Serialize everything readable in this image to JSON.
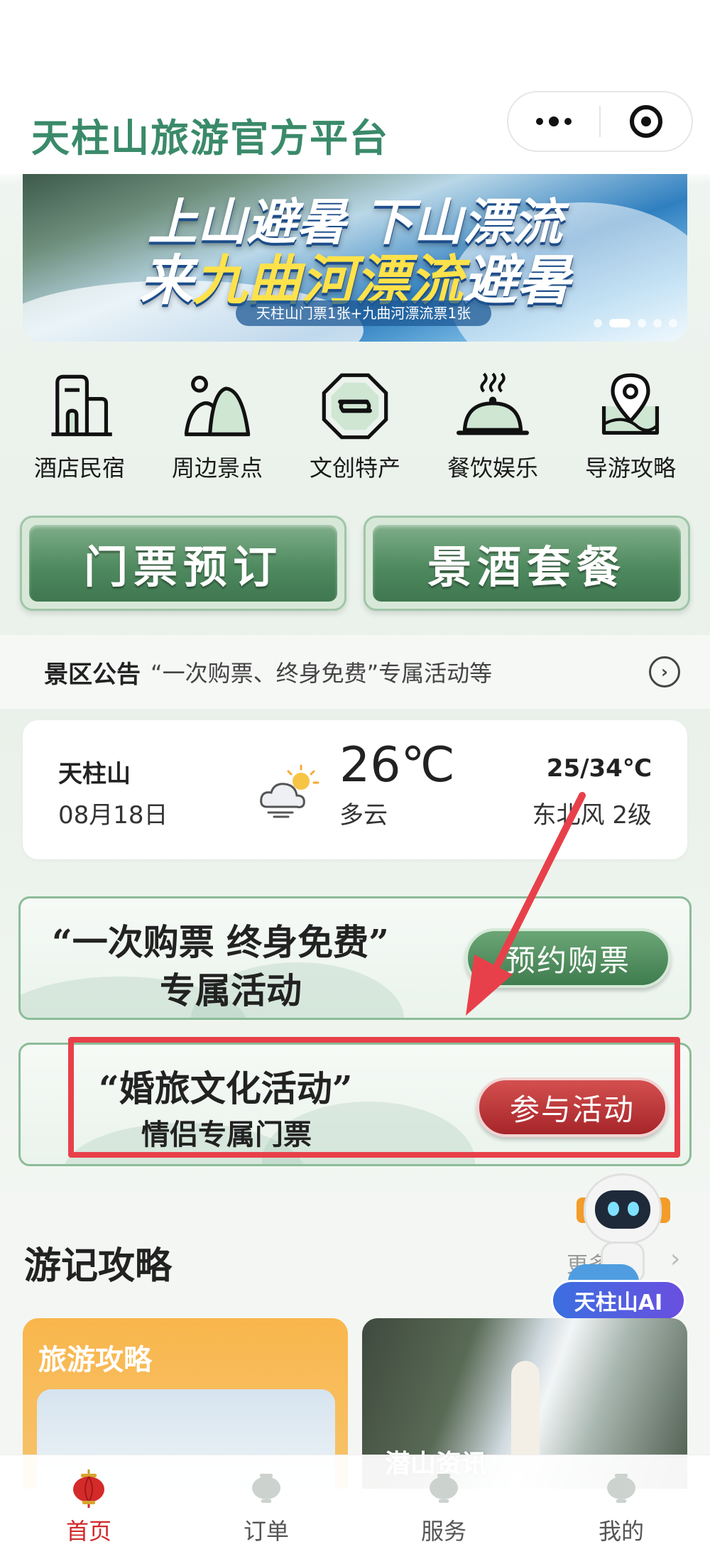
{
  "header": {
    "title": "天柱山旅游官方平台"
  },
  "banner": {
    "line1": "上山避暑 下山漂流",
    "line2_pre": "来",
    "line2_highlight": "九曲河漂流",
    "line2_post": "避暑",
    "subtitle": "天柱山门票1张+九曲河漂流票1张"
  },
  "nav_icons": [
    {
      "label": "酒店民宿",
      "icon": "hotel-icon"
    },
    {
      "label": "周边景点",
      "icon": "mountain-icon"
    },
    {
      "label": "文创特产",
      "icon": "souvenir-icon"
    },
    {
      "label": "餐饮娱乐",
      "icon": "dining-icon"
    },
    {
      "label": "导游攻略",
      "icon": "map-pin-icon"
    }
  ],
  "buttons": {
    "ticket": "门票预订",
    "package": "景酒套餐"
  },
  "notice": {
    "tag": "景区公告",
    "text": "“一次购票、终身免费”专属活动等"
  },
  "weather": {
    "location": "天柱山",
    "date": "08月18日",
    "temp": "26℃",
    "condition": "多云",
    "range": "25/34℃",
    "wind": "东北风 2级"
  },
  "activity1": {
    "title": "“一次购票 终身免费”",
    "subtitle": "专属活动",
    "button": "预约购票"
  },
  "activity2": {
    "title": "“婚旅文化活动”",
    "subtitle": "情侣专属门票",
    "button": "参与活动"
  },
  "section": {
    "title": "游记攻略",
    "more": "更多"
  },
  "mascot": {
    "badge": "天柱山AI",
    "chip": "AI"
  },
  "cards": {
    "card1_label": "旅游攻略",
    "card2_label": "潜山资讯"
  },
  "tabbar": [
    {
      "label": "首页",
      "active": true
    },
    {
      "label": "订单",
      "active": false
    },
    {
      "label": "服务",
      "active": false
    },
    {
      "label": "我的",
      "active": false
    }
  ],
  "colors": {
    "brand_green": "#3a8a6a",
    "highlight_red": "#e8404a",
    "active_tab": "#d22a2a"
  }
}
